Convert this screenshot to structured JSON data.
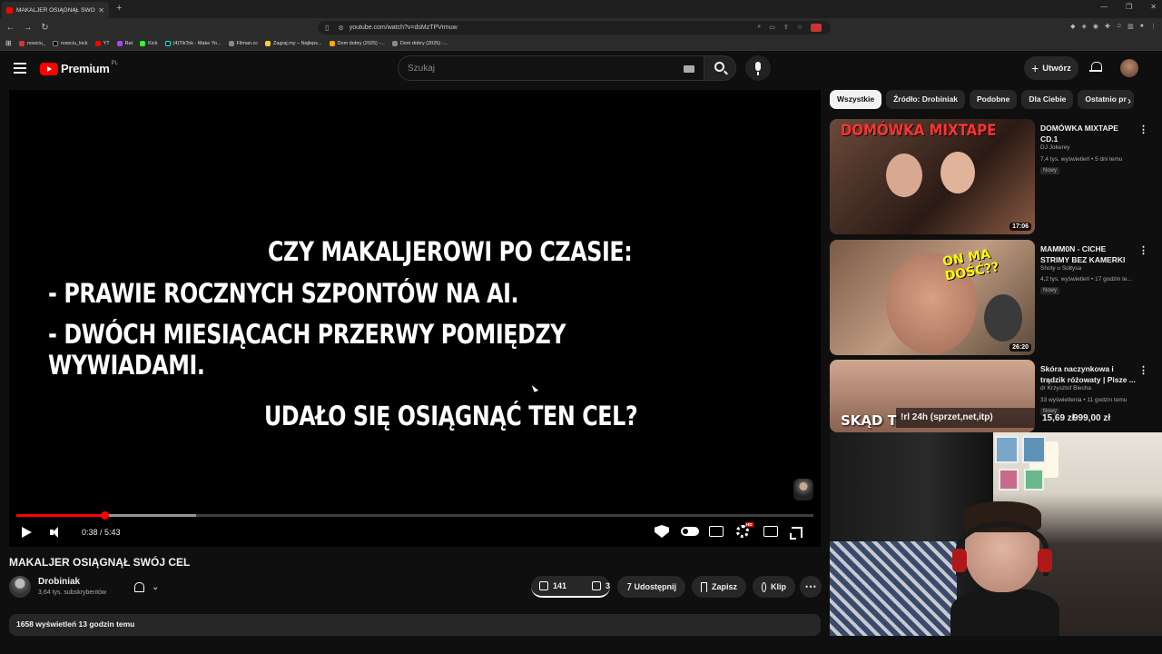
{
  "browser": {
    "tab_title": "MAKALJER OSIĄGNĄŁ SWÓJ CE",
    "url": "youtube.com/watch?v=dsMzTPVrmuw",
    "bookmarks": [
      "nowciu_",
      "nowciu_kick",
      "YT",
      "Rat",
      "Kick",
      "(4)TikTok - Make Yo...",
      "Filman.cc",
      "Zagraj.my – Najleps...",
      "Dom dobry (2025) -...",
      "Dom dobry (2025) -..."
    ]
  },
  "header": {
    "logo": "Premium",
    "logo_region": "PL",
    "search_placeholder": "Szukaj",
    "create_label": "Utwórz"
  },
  "player": {
    "overlay_lines": [
      "CZY MAKALJEROWI PO CZASIE:",
      "- PRAWIE ROCZNYCH SZPONTÓW NA AI.",
      "- DWÓCH MIESIĄCACH PRZERWY POMIĘDZY WYWIADAMI.",
      "UDAŁO SIĘ OSIĄGNĄĆ TEN CEL?"
    ],
    "time": "0:38 / 5:43",
    "progress_fraction": 0.111,
    "buffered_fraction": 0.226
  },
  "video": {
    "title": "MAKALJER OSIĄGNĄŁ SWÓJ CEL",
    "channel": "Drobiniak",
    "subscribers": "3,64 tys. subskrybentów",
    "likes": "141",
    "dislikes": "3",
    "share_label": "Udostępnij",
    "save_label": "Zapisz",
    "clip_label": "Klip",
    "views_date": "1658 wyświetleń  13 godzin temu"
  },
  "chips": [
    "Wszystkie",
    "Źródło: Drobiniak",
    "Podobne",
    "Dla Ciebie",
    "Ostatnio pr"
  ],
  "recommendations": [
    {
      "title": "DOMÓWKA MIXTAPE CD.1",
      "channel": "DJ Jokerey",
      "meta": "7,4 tys. wyświetleń • 5 dni temu",
      "badge": "Nowy",
      "duration": "17:06",
      "thumb_text": "DOMÓWKA MIXTAPE"
    },
    {
      "title": "MAMM0N - CICHE STRIMY BEZ KAMERKI",
      "channel": "Shoty u Sołtysa",
      "meta": "4,2 tys. wyświetleń • 17 godzin te...",
      "badge": "Nowy",
      "duration": "26:20",
      "thumb_text": "ON MA DOŚĆ??"
    },
    {
      "title": "Skóra naczynkowa i trądzik różowaty | Pisze ...",
      "channel": "dr Krzysztof Blecha",
      "meta": "33 wyświetlenia • 11 godzin temu",
      "badge": "Nowy",
      "thumb_text": "SKĄD T"
    }
  ],
  "overlay": {
    "ad_text": "!rl 24h (sprzet,net,itp)",
    "price_old": "15,69 zł",
    "price_new": "999,00 zł"
  }
}
